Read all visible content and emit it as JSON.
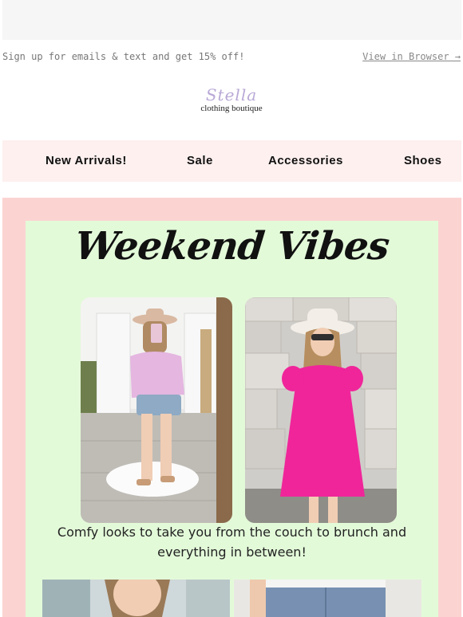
{
  "preheader": {
    "promo_text": "Sign up for emails & text and get 15% off!",
    "view_in_browser": "View in Browser →"
  },
  "logo": {
    "script_text": "Stella",
    "subtitle": "clothing boutique"
  },
  "nav": {
    "items": [
      {
        "label": "New Arrivals!"
      },
      {
        "label": "Sale"
      },
      {
        "label": "Accessories"
      },
      {
        "label": "Shoes"
      }
    ]
  },
  "hero": {
    "headline": "Weekend Vibes",
    "caption_line1": "Comfy looks  to take you from the couch to brunch and",
    "caption_line2": "everything in between!"
  },
  "colors": {
    "nav_bg": "#fdf0ef",
    "hero_outer_bg": "#fbd4d2",
    "hero_inner_bg": "#e3fad9",
    "pink_dress": "#f0259a",
    "lilac_top": "#e4b6e0"
  }
}
